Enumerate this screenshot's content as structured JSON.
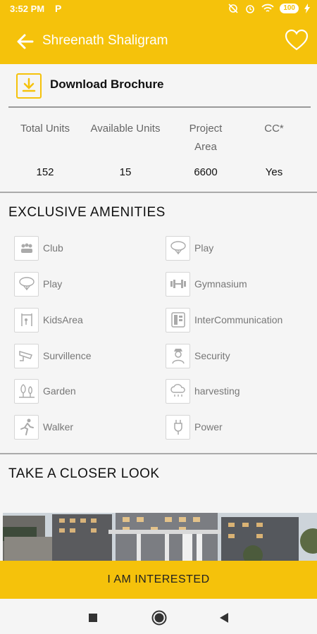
{
  "status": {
    "time": "3:52 PM",
    "carrier_icon": "P",
    "battery": "100"
  },
  "appbar": {
    "title": "Shreenath Shaligram"
  },
  "brochure": {
    "label": "Download Brochure"
  },
  "stats": [
    {
      "label": "Total Units",
      "value": "152"
    },
    {
      "label": "Available Units",
      "value": "15"
    },
    {
      "label": "Project Area",
      "value": "6600"
    },
    {
      "label": "CC*",
      "value": "Yes"
    }
  ],
  "amenities": {
    "title": "EXCLUSIVE AMENITIES",
    "items": [
      {
        "label": "Club",
        "icon": "club-icon"
      },
      {
        "label": "Play",
        "icon": "play-icon"
      },
      {
        "label": "Play",
        "icon": "play-icon"
      },
      {
        "label": "Gymnasium",
        "icon": "dumbbell-icon"
      },
      {
        "label": "KidsArea",
        "icon": "kids-area-icon"
      },
      {
        "label": "InterCommunication",
        "icon": "intercom-icon"
      },
      {
        "label": "Survillence",
        "icon": "cctv-icon"
      },
      {
        "label": "Security",
        "icon": "security-guard-icon"
      },
      {
        "label": "Garden",
        "icon": "garden-icon"
      },
      {
        "label": "harvesting",
        "icon": "rain-cloud-icon"
      },
      {
        "label": "Walker",
        "icon": "walker-icon"
      },
      {
        "label": "Power",
        "icon": "power-plug-icon"
      }
    ]
  },
  "closer": {
    "title": "TAKE A CLOSER LOOK"
  },
  "cta": {
    "label": "I AM INTERESTED"
  },
  "colors": {
    "accent": "#f5c20b",
    "text": "#111111",
    "muted": "#777777"
  }
}
